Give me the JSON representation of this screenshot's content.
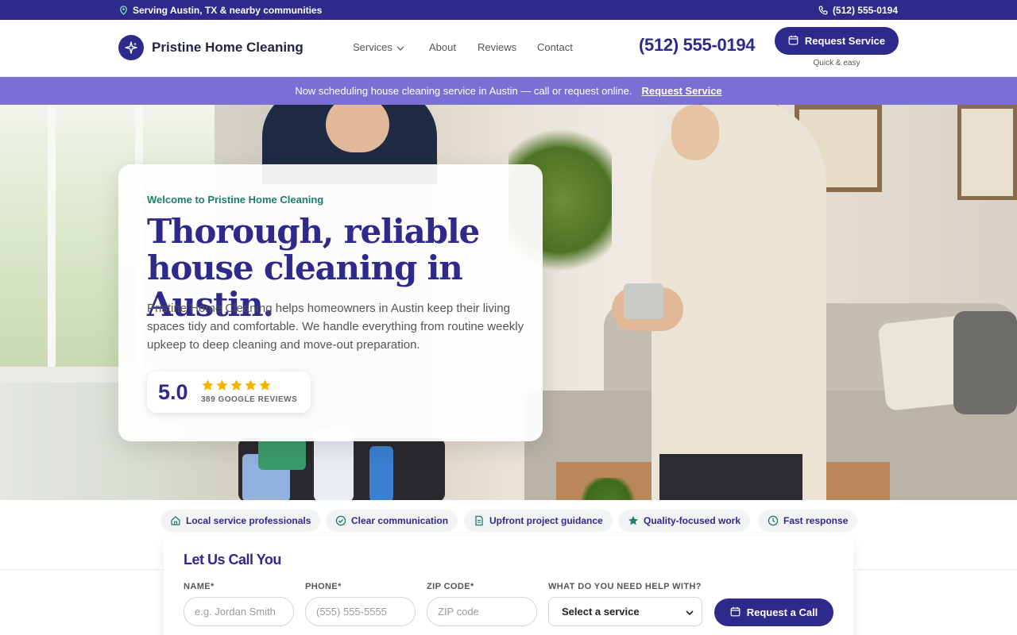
{
  "topbar": {
    "location": "Serving Austin, TX & nearby communities",
    "phone": "(512) 555-0194"
  },
  "header": {
    "brand": "Pristine Home Cleaning",
    "nav": [
      "Services",
      "About",
      "Reviews",
      "Contact"
    ],
    "phone": "(512) 555-0194",
    "cta_label": "Request Service",
    "cta_sub": "Quick & easy"
  },
  "announcement": {
    "text": "Now scheduling house cleaning service in Austin — call or request online.",
    "link": "Request Service"
  },
  "hero": {
    "eyebrow": "Welcome to Pristine Home Cleaning",
    "headline": "Thorough, reliable house cleaning in Austin.",
    "body": "Pristine Home Cleaning helps homeowners in Austin keep their living spaces tidy and comfortable. We handle everything from routine weekly upkeep to deep cleaning and move-out preparation.",
    "rating": {
      "score": "5.0",
      "stars": 5,
      "count_label": "389 GOOGLE REVIEWS"
    }
  },
  "trust_chips": [
    {
      "label": "Local service professionals",
      "icon": "home-icon"
    },
    {
      "label": "Clear communication",
      "icon": "check-circle-icon"
    },
    {
      "label": "Upfront project guidance",
      "icon": "document-icon"
    },
    {
      "label": "Quality-focused work",
      "icon": "star-icon"
    },
    {
      "label": "Fast response",
      "icon": "clock-icon"
    }
  ],
  "call_form": {
    "title": "Let Us Call You",
    "fields": {
      "name_label": "NAME*",
      "name_placeholder": "e.g. Jordan Smith",
      "phone_label": "PHONE*",
      "phone_placeholder": "(555) 555-5555",
      "zip_label": "ZIP CODE*",
      "zip_placeholder": "ZIP code",
      "service_label": "WHAT DO YOU NEED HELP WITH?",
      "service_selected": "Select a service"
    },
    "submit_label": "Request a Call"
  },
  "colors": {
    "brand": "#2e2a8c",
    "announce": "#7b6fd6",
    "accent_green": "#1b7f6a",
    "star": "#f5b301"
  }
}
